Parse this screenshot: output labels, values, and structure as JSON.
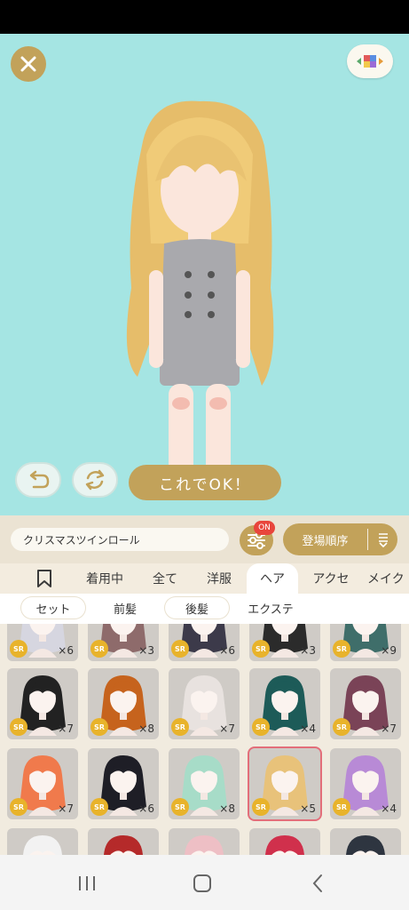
{
  "outfit_name": "クリスマスツインロール",
  "ok_label": "これでOK！",
  "filter_badge": "ON",
  "sort_label": "登場順序",
  "tabs": [
    "着用中",
    "全て",
    "洋服",
    "ヘア",
    "アクセ",
    "メイク"
  ],
  "active_tab": "ヘア",
  "subtabs": [
    "セット",
    "前髪",
    "後髪",
    "エクステ"
  ],
  "rarity_label": "SR",
  "items": [
    {
      "count": "×6",
      "hair": "#d6d6e0"
    },
    {
      "count": "×3",
      "hair": "#8e6b6b"
    },
    {
      "count": "×6",
      "hair": "#3c3a4a"
    },
    {
      "count": "×3",
      "hair": "#2b2b2b"
    },
    {
      "count": "×9",
      "hair": "#3f6e6a"
    },
    {
      "count": "×7",
      "hair": "#222222"
    },
    {
      "count": "×8",
      "hair": "#c6631d"
    },
    {
      "count": "×7",
      "hair": "#e8e2df"
    },
    {
      "count": "×4",
      "hair": "#1d5b58"
    },
    {
      "count": "×7",
      "hair": "#7a4357"
    },
    {
      "count": "×7",
      "hair": "#f07a4c"
    },
    {
      "count": "×6",
      "hair": "#1e1e26"
    },
    {
      "count": "×8",
      "hair": "#a7dcc8"
    },
    {
      "count": "×5",
      "hair": "#e8c27a"
    },
    {
      "count": "×4",
      "hair": "#b88ad6"
    },
    {
      "count": "",
      "hair": "#f2f2f2"
    },
    {
      "count": "",
      "hair": "#b52a2a"
    },
    {
      "count": "",
      "hair": "#eebfc5"
    },
    {
      "count": "",
      "hair": "#d0304c"
    },
    {
      "count": "",
      "hair": "#2e3540"
    }
  ],
  "selected_item": 13,
  "colors": {
    "gold": "#c2a25a",
    "stage": "#a5e5e3",
    "badge": "#e8453c",
    "sr": "#e8b32b"
  }
}
